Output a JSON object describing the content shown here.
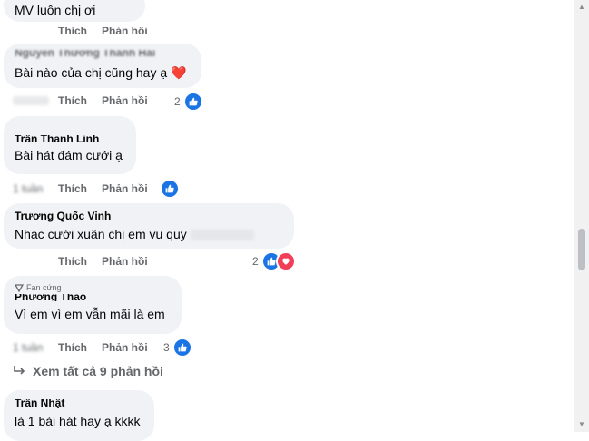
{
  "comments": [
    {
      "author": "",
      "text": "MV luôn chị ơi",
      "like_label": "Thích",
      "reply_label": "Phản hồi",
      "reaction_count": ""
    },
    {
      "author": "Nguyễn Thương Thanh Hải",
      "text": "Bài nào của chị cũng hay ạ",
      "emoji": "❤️",
      "time": "",
      "like_label": "Thích",
      "reply_label": "Phản hồi",
      "reaction_count": "2"
    },
    {
      "author": "Trần Thanh Linh",
      "text": "Bài hát đám cưới ạ",
      "time": "1 tuần",
      "like_label": "Thích",
      "reply_label": "Phản hồi",
      "reaction_count": ""
    },
    {
      "author": "Trương Quốc Vinh",
      "text": "Nhạc cưới xuân chị em vu quy",
      "like_label": "Thích",
      "reply_label": "Phản hồi",
      "reaction_count": "2"
    },
    {
      "badge": "Fan cứng",
      "author": "Phương Thảo",
      "text": "Vì em vì em vẫn mãi là em",
      "time": "1 tuần",
      "like_label": "Thích",
      "reply_label": "Phản hồi",
      "reaction_count": "3"
    },
    {
      "author": "Trần Nhật",
      "text": "là 1 bài hát hay ạ kkkk"
    }
  ],
  "view_more_replies": "Xem tất cả 9 phản hồi",
  "colors": {
    "bubble": "#f0f2f5",
    "like_blue": "#1b74e4",
    "love_red": "#f33e58",
    "meta_gray": "#65676b"
  },
  "icons": {
    "like": "thumbs-up-icon",
    "love": "heart-icon",
    "reply_arrow": "reply-arrow-icon",
    "fan_badge": "badge-icon"
  }
}
